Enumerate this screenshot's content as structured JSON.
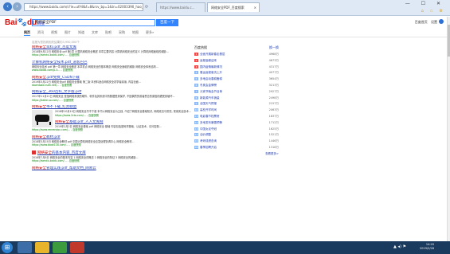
{
  "browser": {
    "address": "https://www.baidu.com/s?ie=utf-8&f=8&rsv_bp=1&tn=02003390_hao_pg&wd=目前安全PDF",
    "tab_inactive": "https://www.baidu.c...",
    "tab_active": "网络安全PDF_百度搜索",
    "tab_close": "×",
    "win_controls": "— ☐ ✕",
    "tools": "⌂ ☆ ⚙"
  },
  "header": {
    "logo_bai": "Bai",
    "logo_du": "du",
    "logo_suffix": "百度",
    "search_value": "网络安全PDF",
    "search_button": "百度一下",
    "links": "百度首页  设置",
    "user": "●"
  },
  "tabs": [
    "网页",
    "资讯",
    "视频",
    "图片",
    "知道",
    "文库",
    "贴吧",
    "采购",
    "地图",
    "更多»"
  ],
  "result_count": "百度为您找到相关结果约3,950,000个",
  "results": [
    {
      "title_pre": "网络安全",
      "title_hl": "",
      "title": "资料.pdf_百度文库",
      "desc": "2018年9月12日 网络安全 pdf 第1章 计算机网络安全概述 本章主要内容 计算机网络安全的定义 计算机网络面临的威胁...",
      "url": "https://wenku.baidu.com/... - 百度快照"
    },
    {
      "title_pre": "",
      "title_hl": "",
      "title": "计算机网络安全技术.pdf_道客巴巴",
      "desc": "网络安全技术 pdf 第一章 网络安全概述 本章重点 网络安全的基本概念 网络安全面临的威胁 网络安全体系结构...",
      "url": "www.doc88.com/p-3... - 百度快照"
    },
    {
      "title_pre": "网络安全",
      "title_hl": "",
      "title": ".pdf免费_CSDN下载",
      "desc": "2019年3月22日 网络安全pdf 网络安全基础 第二版 本资料适合网络安全初学者阅读, 内容全面...",
      "url": "download.csdn.net/... - 百度快照"
    },
    {
      "title_pre": "",
      "title_hl": "",
      "title": "网络安全_360百科_文字版.pdf",
      "desc": "2017年11月21日 网络安全 是指网络系统的硬件、软件及其系统中的数据受到保护, 不因偶然的或者恶意的原因而遭受到破坏...",
      "url": "https://baike.so.com/... - 百度快照"
    },
    {
      "title_pre": "网络安全",
      "title_hl": "",
      "title": "书不下载_红黑联盟",
      "desc": "2018年10月19日 网络安全书不下载 本书以网络安全为主线, 介绍了网络安全基础知识, 网络攻击与防范, 常用安全技术...",
      "url": "https://www.2cto.com/... - 百度快照"
    },
    {
      "title_pre": "网络安全",
      "title_hl": "",
      "title": "基础.pdf_人人文库网",
      "desc": "2019年2月2日 网络安全基础 pdf 网络安全 基础 内容包括密码学基础、认证技术、访问控制...",
      "url": "https://www.renrendoc.com/... - 百度快照"
    },
    {
      "title_pre": "网络安全",
      "title_hl": "",
      "title": "教材.pdf",
      "desc": "2018年3月15日 网络安全教材 pdf 中国计算机网络安全应急处理协调中心 网络安全教材...",
      "url": "https://www.book118.com/... - 百度快照"
    },
    {
      "title_pre": "网络安全",
      "title_hl": "",
      "title": "的基本内容_百度文库",
      "desc": "2016年7月8日 网络安全的基本内容 1 网络安全的概念 2 网络安全的特征 3 网络安全的威胁...",
      "url": "https://wenku.baidu.com/... - 百度快照"
    },
    {
      "title_pre": "网络安全",
      "title_hl": "",
      "title": "管理实践.pdf_帮助文档_网易云",
      "desc": "",
      "url": ""
    }
  ],
  "hotlist": {
    "title": "百度热搜",
    "refresh": "换一换",
    "items": [
      {
        "rank": "1",
        "text": "全面开展新春走基层",
        "heat": "4968万"
      },
      {
        "rank": "2",
        "text": "返程高峰迎来",
        "heat": "4673万"
      },
      {
        "rank": "3",
        "text": "国内疫情最新情况",
        "heat": "4317万"
      },
      {
        "rank": "4",
        "text": "春运返程客流上升",
        "heat": "4077万"
      },
      {
        "rank": "5",
        "text": "多地启动春耕备耕",
        "heat": "3654万"
      },
      {
        "rank": "6",
        "text": "冬奥会金牌榜",
        "heat": "3213万"
      },
      {
        "rank": "7",
        "text": "元宵节晚会节目单",
        "heat": "2927万"
      },
      {
        "rank": "8",
        "text": "新能源汽车销量",
        "heat": "2498万"
      },
      {
        "rank": "9",
        "text": "全国天气预报",
        "heat": "2157万"
      },
      {
        "rank": "10",
        "text": "高校开学时间",
        "heat": "2063万"
      },
      {
        "rank": "11",
        "text": "电影春节档票房",
        "heat": "1837万"
      },
      {
        "rank": "12",
        "text": "多地发布暴雪预警",
        "heat": "1712万"
      },
      {
        "rank": "13",
        "text": "中国女足夺冠",
        "heat": "1625万"
      },
      {
        "rank": "14",
        "text": "油价调整",
        "heat": "1521万"
      },
      {
        "rank": "15",
        "text": "考研成绩查询",
        "heat": "1446万"
      },
      {
        "rank": "16",
        "text": "春季招聘开启",
        "heat": "1318万"
      }
    ],
    "more": "查看更多>"
  },
  "taskbar": {
    "start": "⊞",
    "tray_icons": "▲ ◂) ⚑",
    "time": "14:20",
    "date": "2019/2/28"
  }
}
